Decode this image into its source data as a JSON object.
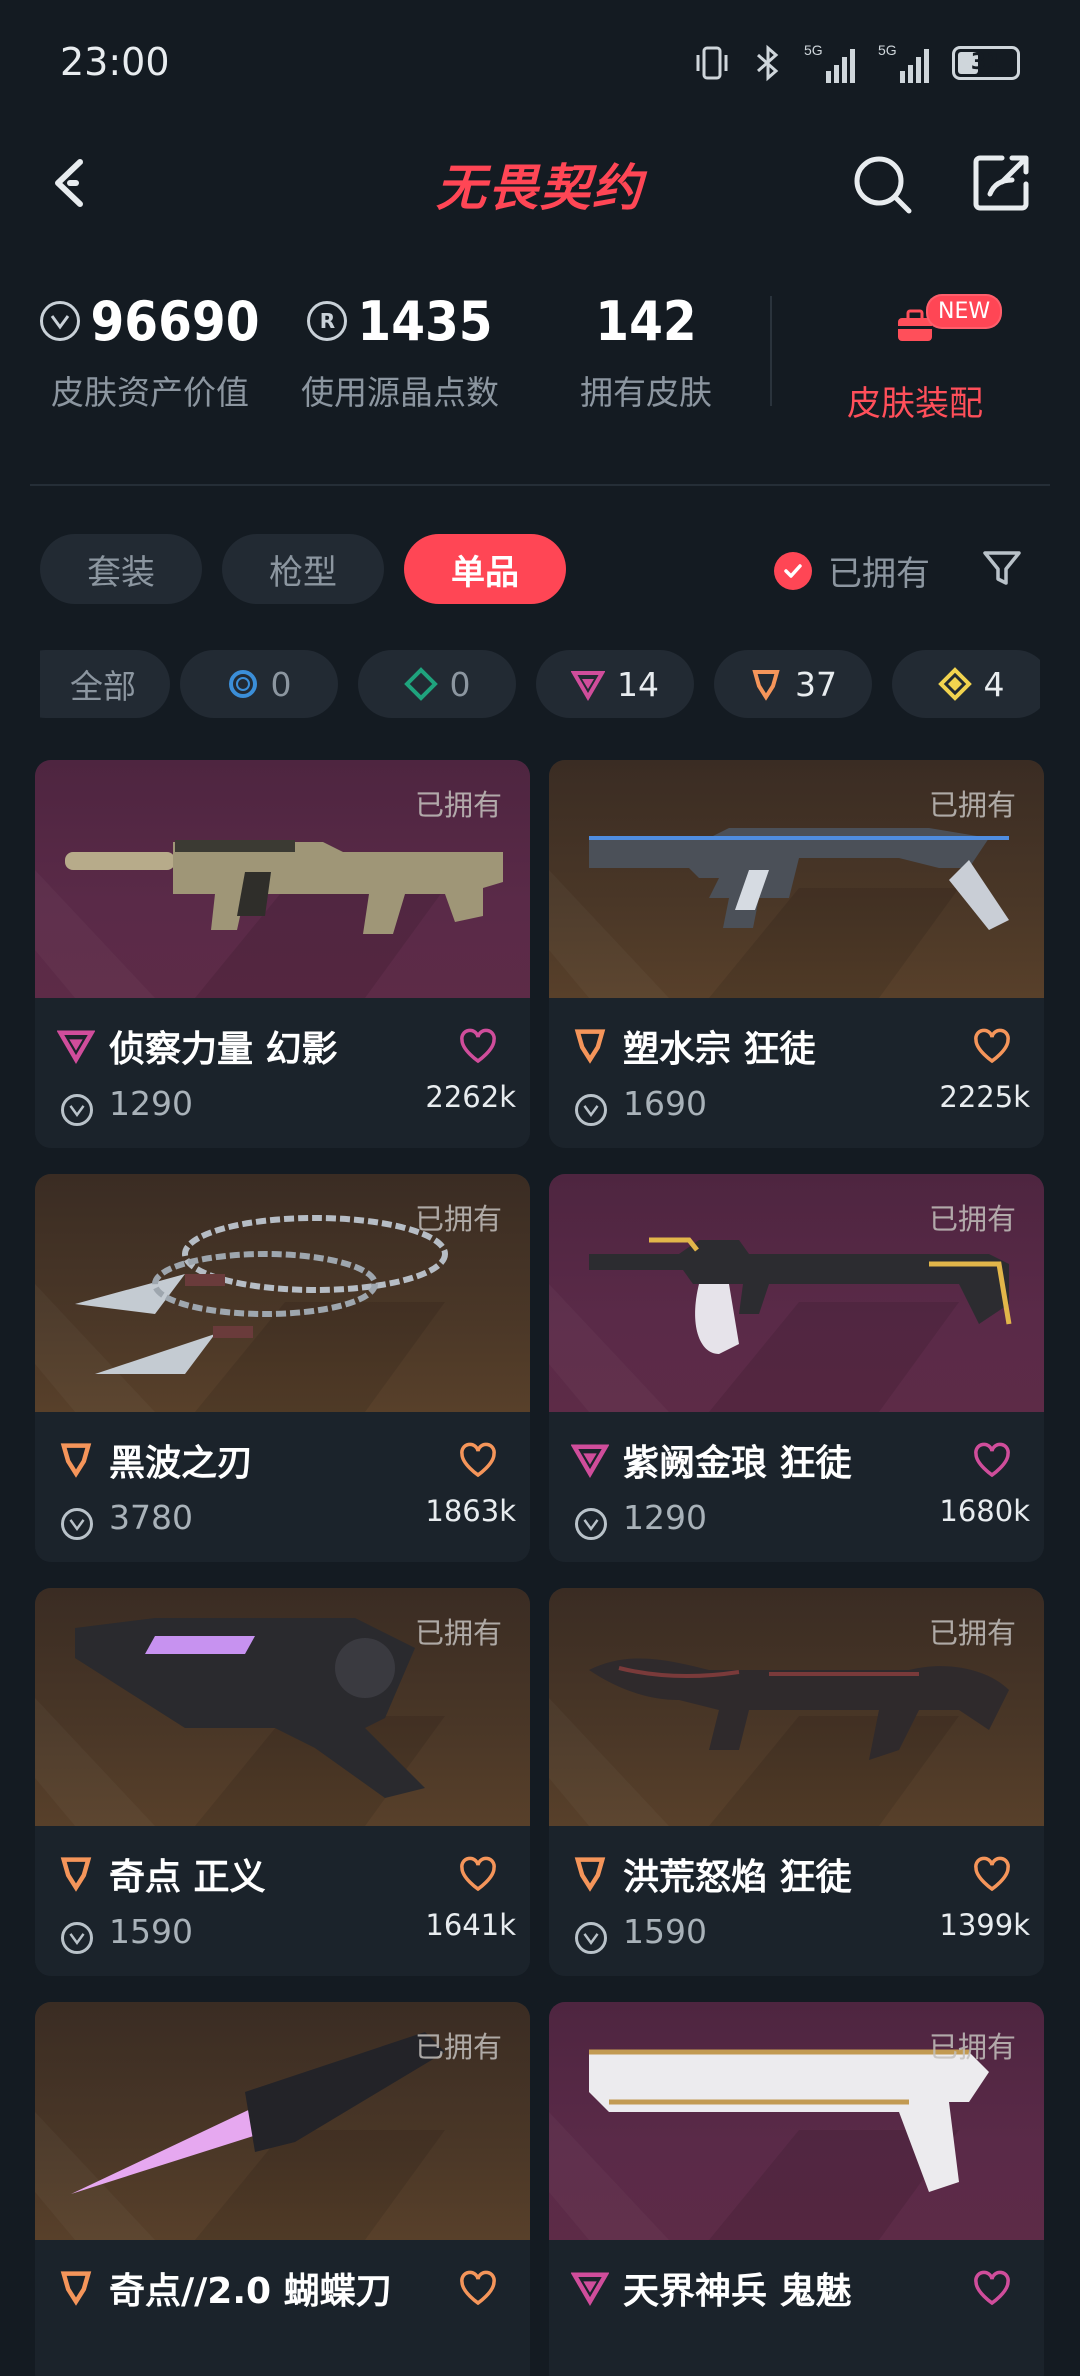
{
  "status_bar": {
    "time": "23:00",
    "battery": "31",
    "network1": "5G",
    "network2": "5G"
  },
  "header": {
    "title": "无畏契约"
  },
  "stats": [
    {
      "value": "96690",
      "label": "皮肤资产价值",
      "icon": "vp-coin-icon"
    },
    {
      "value": "1435",
      "label": "使用源晶点数",
      "icon": "radianite-icon"
    },
    {
      "value": "142",
      "label": "拥有皮肤"
    }
  ],
  "equip": {
    "label": "皮肤装配",
    "badge": "NEW"
  },
  "tabs": [
    {
      "label": "套装"
    },
    {
      "label": "枪型"
    },
    {
      "label": "单品",
      "active": true
    }
  ],
  "owned_filter": {
    "label": "已拥有",
    "checked": true
  },
  "rarity_chips": [
    {
      "label": "全部",
      "count": ""
    },
    {
      "count": "0",
      "tier": "select",
      "color": "#3b8ed8"
    },
    {
      "count": "0",
      "tier": "deluxe",
      "color": "#1fa37d"
    },
    {
      "count": "14",
      "tier": "premium",
      "color": "#d04d9b"
    },
    {
      "count": "37",
      "tier": "exclusive",
      "color": "#f5955a"
    },
    {
      "count": "4",
      "tier": "ultra",
      "color": "#f1d34f"
    }
  ],
  "cards": [
    {
      "name": "侦察力量 幻影",
      "price": "1290",
      "likes": "2262k",
      "owned": "已拥有",
      "tier": "premium",
      "theme": "purple",
      "weapon": "rifle-tan"
    },
    {
      "name": "塑水宗 狂徒",
      "price": "1690",
      "likes": "2225k",
      "owned": "已拥有",
      "tier": "exclusive",
      "theme": "gold",
      "weapon": "rifle-silver"
    },
    {
      "name": "黑波之刃",
      "price": "3780",
      "likes": "1863k",
      "owned": "已拥有",
      "tier": "exclusive",
      "theme": "gold",
      "weapon": "kunai"
    },
    {
      "name": "紫阙金琅 狂徒",
      "price": "1290",
      "likes": "1680k",
      "owned": "已拥有",
      "tier": "premium",
      "theme": "purple",
      "weapon": "rifle-white"
    },
    {
      "name": "奇点 正义",
      "price": "1590",
      "likes": "1641k",
      "owned": "已拥有",
      "tier": "exclusive",
      "theme": "gold",
      "weapon": "revolver"
    },
    {
      "name": "洪荒怒焰 狂徒",
      "price": "1590",
      "likes": "1399k",
      "owned": "已拥有",
      "tier": "exclusive",
      "theme": "gold",
      "weapon": "rifle-dark"
    },
    {
      "name": "奇点//2.0 蝴蝶刀",
      "price": "",
      "likes": "",
      "owned": "已拥有",
      "tier": "exclusive",
      "theme": "gold",
      "weapon": "knife"
    },
    {
      "name": "天界神兵 鬼魅",
      "price": "",
      "likes": "",
      "owned": "已拥有",
      "tier": "premium",
      "theme": "purple",
      "weapon": "pistol"
    }
  ]
}
